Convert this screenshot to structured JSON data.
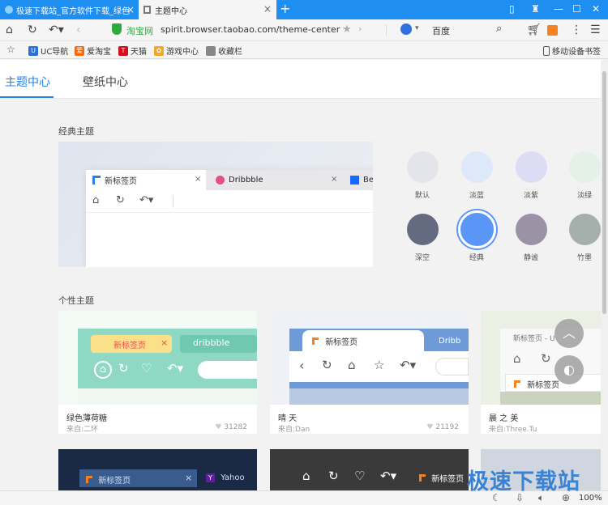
{
  "browser": {
    "tabs": [
      {
        "title": "极速下载站_官方软件下载_绿色",
        "close": "×"
      },
      {
        "title": "主题中心",
        "close": "×"
      }
    ],
    "new_tab": "+",
    "address": {
      "site": "淘宝网",
      "url": "spirit.browser.taobao.com/theme-center"
    },
    "search": {
      "engine": "百度"
    },
    "bookmarks": [
      {
        "label": "UC导航",
        "icon": "uc-icon",
        "color": "#2a6fdb"
      },
      {
        "label": "爱淘宝",
        "icon": "aitaobao-icon",
        "color": "#f26b0f"
      },
      {
        "label": "天猫",
        "icon": "tmall-icon",
        "color": "#d4101c"
      },
      {
        "label": "游戏中心",
        "icon": "game-icon",
        "color": "#f5a623"
      },
      {
        "label": "收藏栏",
        "icon": "folder-icon",
        "color": "#888888"
      }
    ],
    "mobile_bookmarks": "移动设备书签",
    "zoom": "100%"
  },
  "theme_center": {
    "tabs": [
      {
        "label": "主题中心"
      },
      {
        "label": "壁纸中心"
      }
    ],
    "classic_title": "经典主题",
    "classic_preview": {
      "tab1": "新标签页",
      "tab2": "Dribbble",
      "tab3": "Be"
    },
    "swatches": [
      {
        "label": "默认",
        "color": "#e3e5ea"
      },
      {
        "label": "淡蓝",
        "color": "#dde8f8"
      },
      {
        "label": "淡紫",
        "color": "#dcdcf5"
      },
      {
        "label": "淡绿",
        "color": "#e3f1e6"
      },
      {
        "label": "深空",
        "color": "#646b80"
      },
      {
        "label": "经典",
        "color": "#5a96f6"
      },
      {
        "label": "静谧",
        "color": "#9b92a5"
      },
      {
        "label": "竹墨",
        "color": "#a5b0ad"
      }
    ],
    "personal_title": "个性主题",
    "cards": [
      {
        "name": "绿色薄荷糖",
        "source": "来自:二环",
        "likes": "31282",
        "tab_label": "新标签页",
        "tab2": "dribbble"
      },
      {
        "name": "晴 天",
        "source": "来自:Dan",
        "likes": "21192",
        "tab_label": "新标签页",
        "tab2": "Dribb"
      },
      {
        "name": "晨 之 美",
        "source": "来自:Three.Tu",
        "likes": "",
        "tab_label": "新标签页",
        "tab2": "U"
      }
    ],
    "bottom_cards": [
      {
        "tab_label": "新标签页",
        "tab2": "Yahoo"
      },
      {
        "tab_label": "新标签页"
      }
    ]
  },
  "watermark": "极速下载站"
}
